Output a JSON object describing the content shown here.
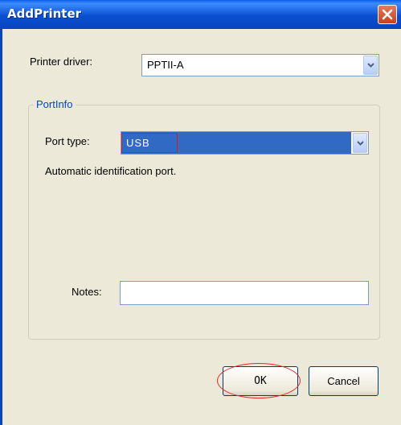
{
  "window": {
    "title": "AddPrinter",
    "close_icon": "close-icon"
  },
  "printer_driver": {
    "label": "Printer driver:",
    "value": "PPTII-A"
  },
  "port_info": {
    "legend": "PortInfo",
    "port_type_label": "Port type:",
    "port_type_value": "USB",
    "description": "Automatic identification port.",
    "notes_label": "Notes:",
    "notes_value": ""
  },
  "buttons": {
    "ok_label": "OK",
    "cancel_label": "Cancel"
  },
  "colors": {
    "titlebar": "#0a4fd0",
    "selection": "#316ac5",
    "annotation": "#e11818",
    "legend_text": "#0046d5"
  }
}
